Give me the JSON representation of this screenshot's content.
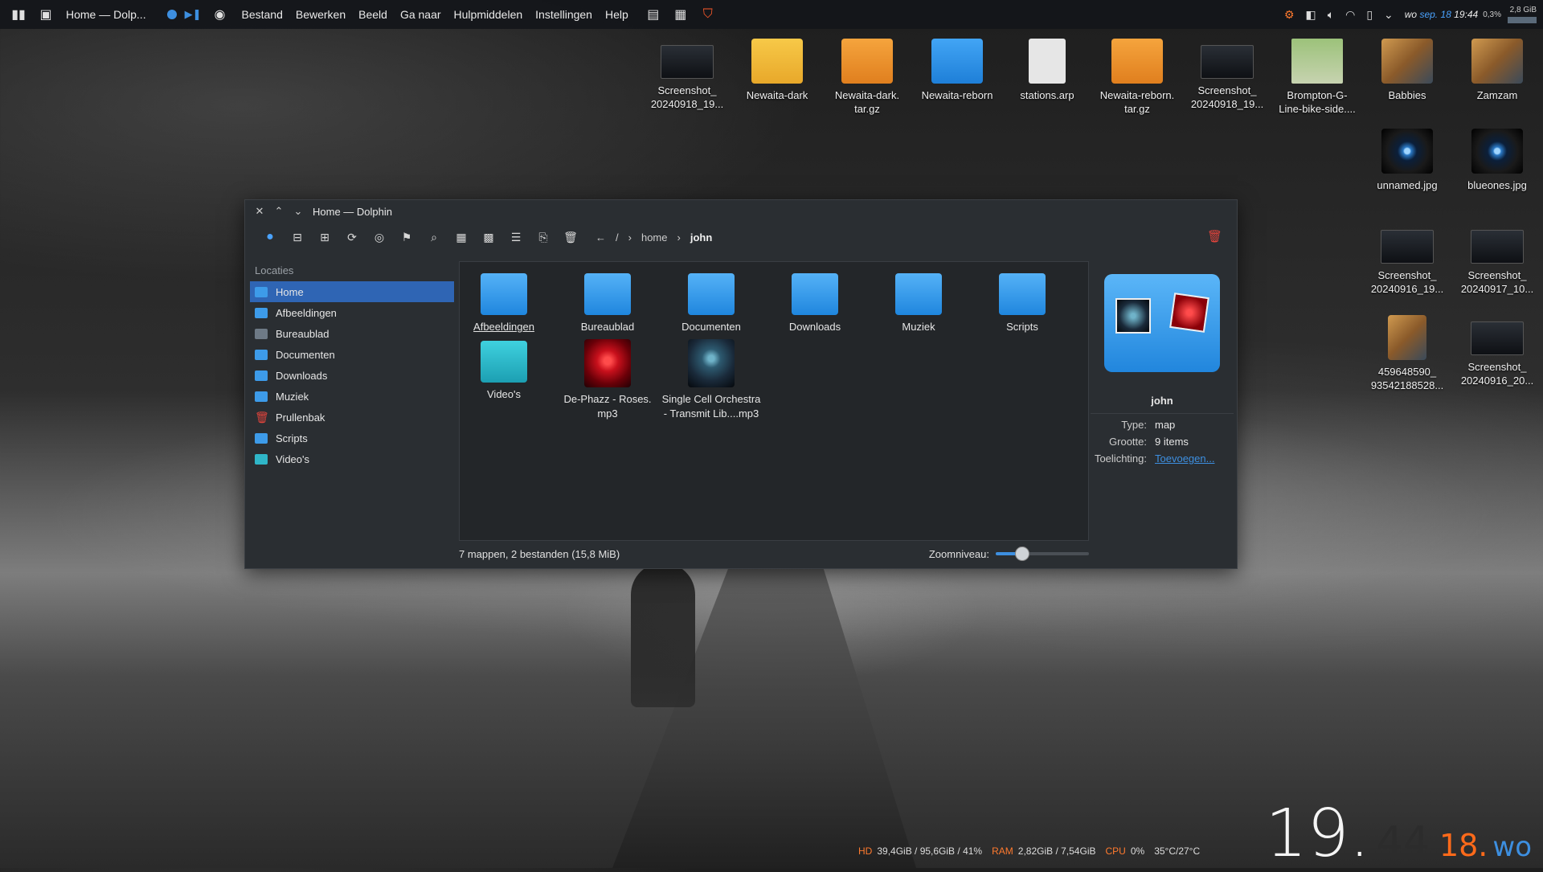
{
  "taskbar": {
    "window_title": "Home — Dolp...",
    "menu": [
      "Bestand",
      "Bewerken",
      "Beeld",
      "Ga naar",
      "Hulpmiddelen",
      "Instellingen",
      "Help"
    ],
    "date_prefix": "wo",
    "date": "sep. 18",
    "time": "19:44",
    "cpu_load": "0,3%",
    "mem": "2,8 GiB"
  },
  "desktop": {
    "icons": [
      {
        "label": "Screenshot_ 20240918_19...",
        "kind": "screenshot"
      },
      {
        "label": "Newaita-dark",
        "kind": "folder-yellow"
      },
      {
        "label": "Newaita-dark. tar.gz",
        "kind": "archive"
      },
      {
        "label": "Newaita-reborn",
        "kind": "folder-blue"
      },
      {
        "label": "stations.arp",
        "kind": "text-file"
      },
      {
        "label": "Newaita-reborn. tar.gz",
        "kind": "archive"
      },
      {
        "label": "Screenshot_ 20240918_19...",
        "kind": "screenshot"
      },
      {
        "label": "Brompton-G- Line-bike-side....",
        "kind": "image"
      },
      {
        "label": "Babbies",
        "kind": "folder-collage"
      },
      {
        "label": "Zamzam",
        "kind": "folder-collage"
      },
      {
        "label": "unnamed.jpg",
        "kind": "image-eye"
      },
      {
        "label": "blueones.jpg",
        "kind": "image-eye"
      },
      {
        "label": "Screenshot_ 20240916_19...",
        "kind": "screenshot"
      },
      {
        "label": "Screenshot_ 20240917_10...",
        "kind": "screenshot"
      },
      {
        "label": "459648590_ 93542188528...",
        "kind": "image"
      },
      {
        "label": "Screenshot_ 20240916_20...",
        "kind": "screenshot"
      }
    ]
  },
  "window": {
    "title": "Home — Dolphin",
    "breadcrumb": {
      "root": "/",
      "parts": [
        "home"
      ],
      "current": "john"
    },
    "sidebar": {
      "header": "Locaties",
      "items": [
        {
          "label": "Home",
          "icon": "folder-home-icon"
        },
        {
          "label": "Afbeeldingen",
          "icon": "folder-pictures-icon"
        },
        {
          "label": "Bureaublad",
          "icon": "folder-desktop-icon"
        },
        {
          "label": "Documenten",
          "icon": "folder-documents-icon"
        },
        {
          "label": "Downloads",
          "icon": "folder-downloads-icon"
        },
        {
          "label": "Muziek",
          "icon": "folder-music-icon"
        },
        {
          "label": "Prullenbak",
          "icon": "trash-icon"
        },
        {
          "label": "Scripts",
          "icon": "folder-scripts-icon"
        },
        {
          "label": "Video's",
          "icon": "folder-videos-icon"
        }
      ]
    },
    "files": [
      {
        "label": "Afbeeldingen",
        "kind": "folder"
      },
      {
        "label": "Bureaublad",
        "kind": "folder"
      },
      {
        "label": "Documenten",
        "kind": "folder"
      },
      {
        "label": "Downloads",
        "kind": "folder"
      },
      {
        "label": "Muziek",
        "kind": "folder"
      },
      {
        "label": "Scripts",
        "kind": "folder"
      },
      {
        "label": "Video's",
        "kind": "folder"
      },
      {
        "label": "De-Phazz - Roses. mp3",
        "kind": "audio"
      },
      {
        "label": "Single Cell Orchestra - Transmit Lib....mp3",
        "kind": "audio"
      }
    ],
    "status": "7 mappen, 2 bestanden (15,8 MiB)",
    "zoom_label": "Zoomniveau:",
    "zoom_level": 0.28,
    "info": {
      "name": "john",
      "type_label": "Type:",
      "type": "map",
      "size_label": "Grootte:",
      "size": "9 items",
      "comment_label": "Toelichting:",
      "comment_link": "Toevoegen..."
    }
  },
  "bottom_bar": {
    "hd_label": "HD",
    "hd": "39,4GiB / 95,6GiB / 41%",
    "ram_label": "RAM",
    "ram": "2,82GiB / 7,54GiB",
    "cpu_label": "CPU",
    "cpu": "0%",
    "temp": "35°C/27°C"
  },
  "clock": {
    "hour": "19.",
    "minute": "44",
    "day": "18.",
    "weekday": "wo"
  },
  "colors": {
    "accent": "#3d8fe0",
    "selection": "#2f65b4",
    "orange": "#ff6a1a",
    "trash": "#e0443c"
  }
}
